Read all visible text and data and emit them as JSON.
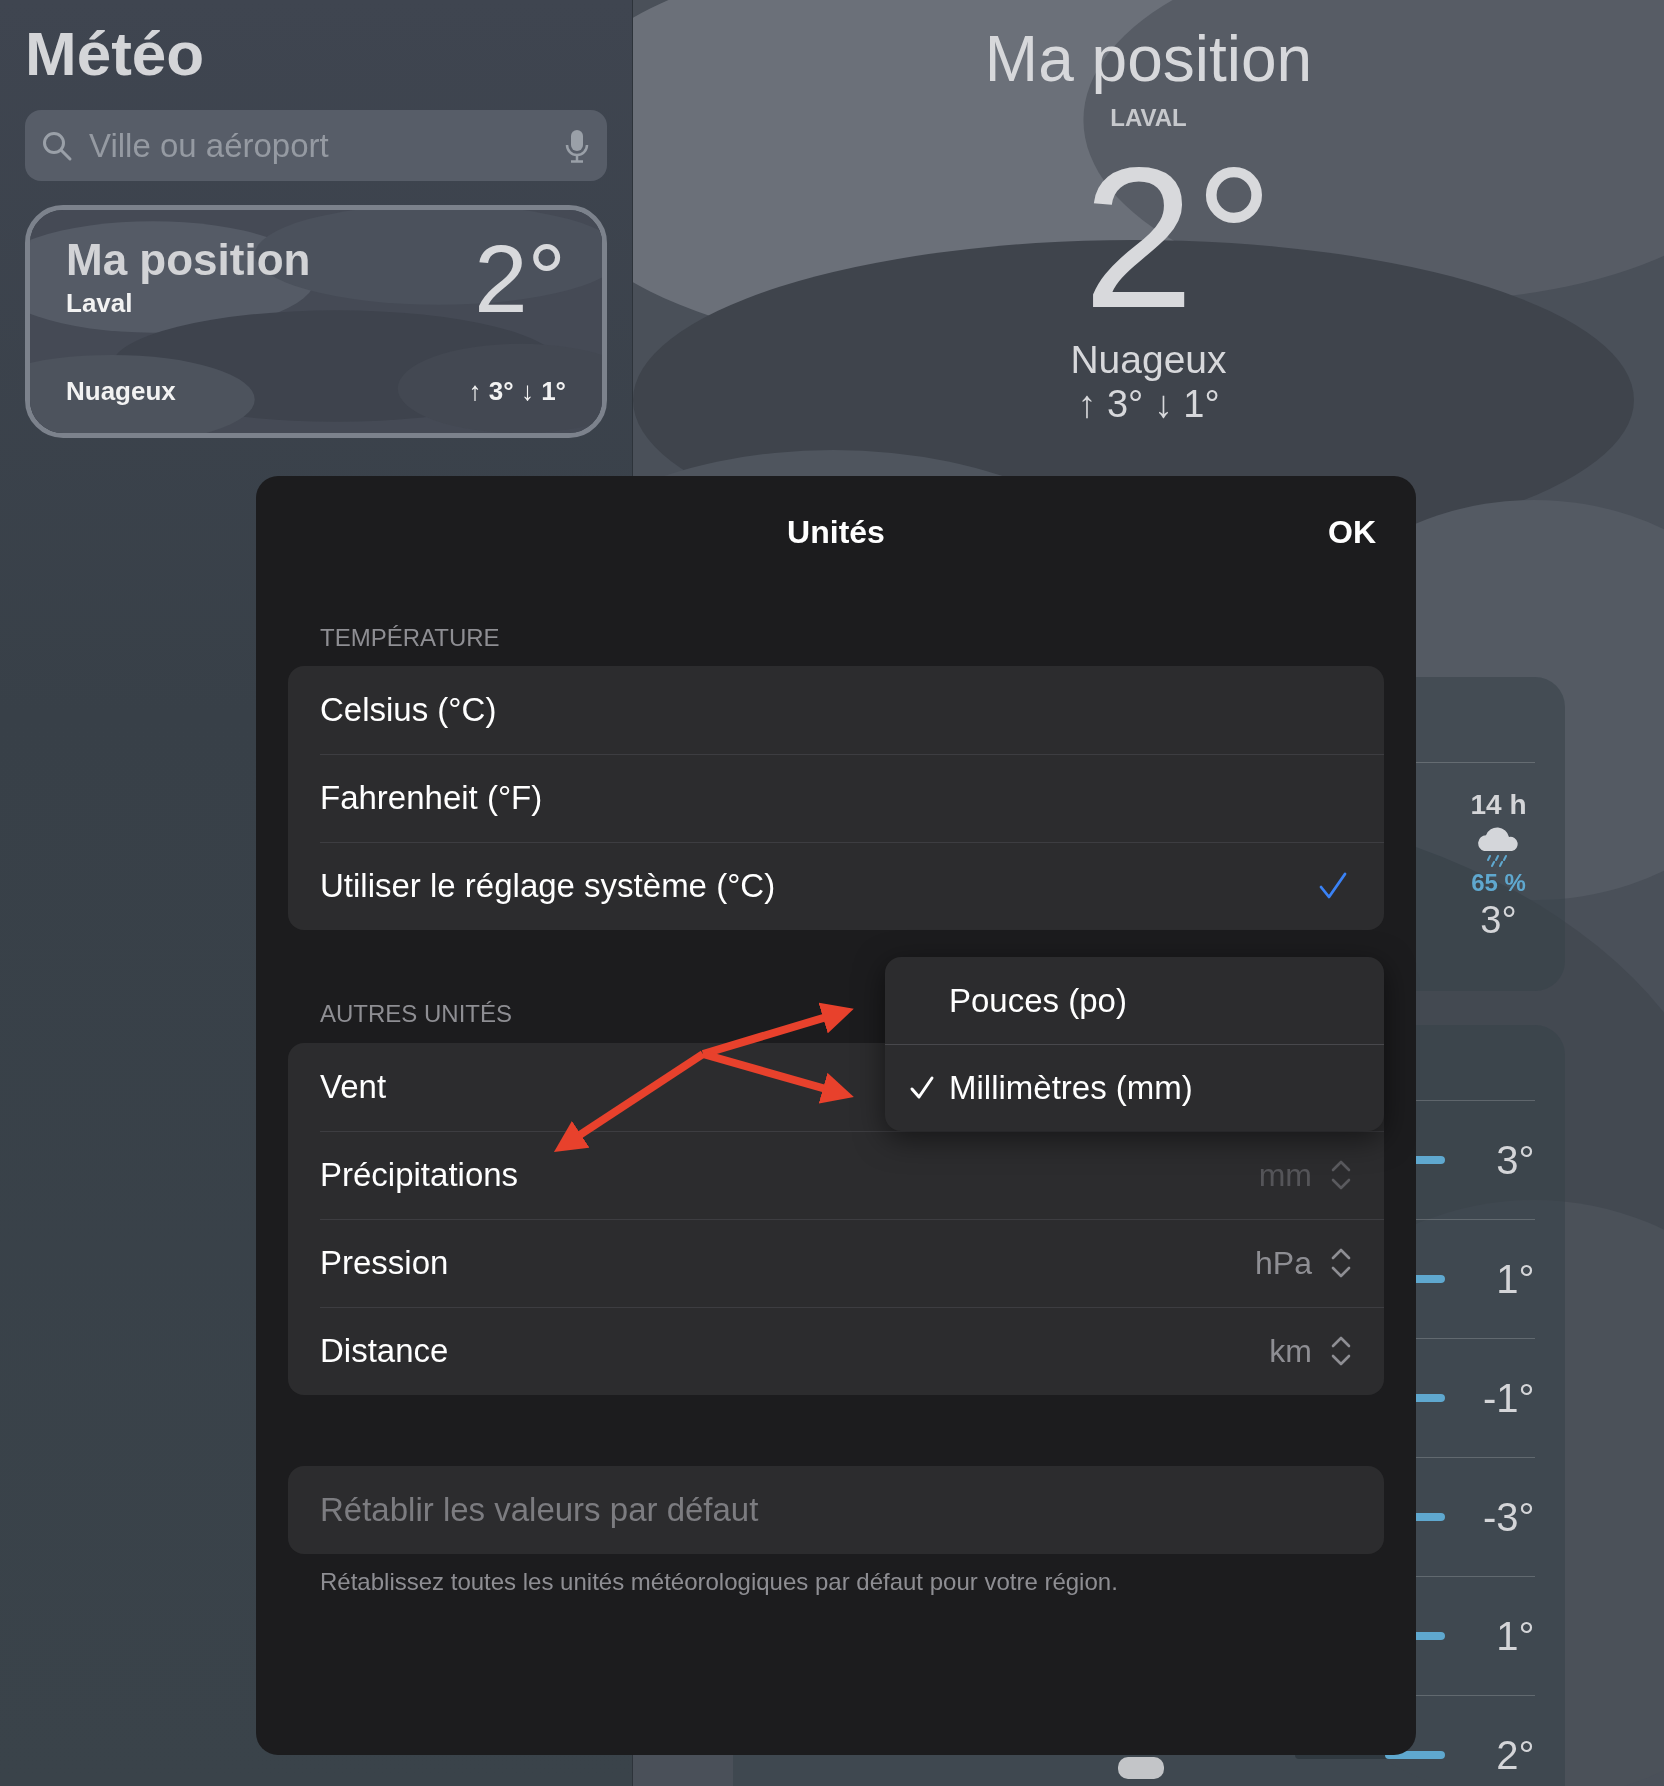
{
  "sidebar": {
    "title": "Météo",
    "search": {
      "placeholder": "Ville ou aéroport"
    },
    "locations": [
      {
        "name": "Ma position",
        "subtitle": "Laval",
        "temperature": "2°",
        "condition": "Nuageux",
        "range": "↑ 3° ↓ 1°",
        "selected": true
      }
    ]
  },
  "header": {
    "location": "Ma position",
    "city": "LAVAL",
    "temperature": "2°",
    "condition": "Nuageux",
    "range": "↑ 3° ↓ 1°"
  },
  "hourly": [
    {
      "time": "14 h",
      "chance": "65 %",
      "temperature": "3°"
    }
  ],
  "daily": [
    {
      "high": "3°"
    },
    {
      "high": "1°"
    },
    {
      "high": "-1°"
    },
    {
      "high": "-3°"
    },
    {
      "high": "1°"
    },
    {
      "high": "2°"
    }
  ],
  "dialog": {
    "title": "Unités",
    "done": "OK",
    "sections": [
      {
        "header": "TEMPÉRATURE",
        "kind": "choice",
        "rows": [
          {
            "label": "Celsius (°C)",
            "selected": false
          },
          {
            "label": "Fahrenheit (°F)",
            "selected": false
          },
          {
            "label": "Utiliser le réglage système (°C)",
            "selected": true
          }
        ]
      },
      {
        "header": "AUTRES UNITÉS",
        "kind": "picker",
        "rows": [
          {
            "label": "Vent"
          },
          {
            "label": "Précipitations",
            "value": "mm",
            "open": true
          },
          {
            "label": "Pression",
            "value": "hPa",
            "open": false
          },
          {
            "label": "Distance",
            "value": "km",
            "open": false
          }
        ]
      }
    ],
    "reset": {
      "label": "Rétablir les valeurs par défaut",
      "disabled": true
    },
    "footer": "Rétablissez toutes les unités météorologiques par défaut pour votre région.",
    "popover": {
      "options": [
        {
          "label": "Pouces (po)",
          "selected": false
        },
        {
          "label": "Millimètres (mm)",
          "selected": true
        }
      ]
    }
  }
}
